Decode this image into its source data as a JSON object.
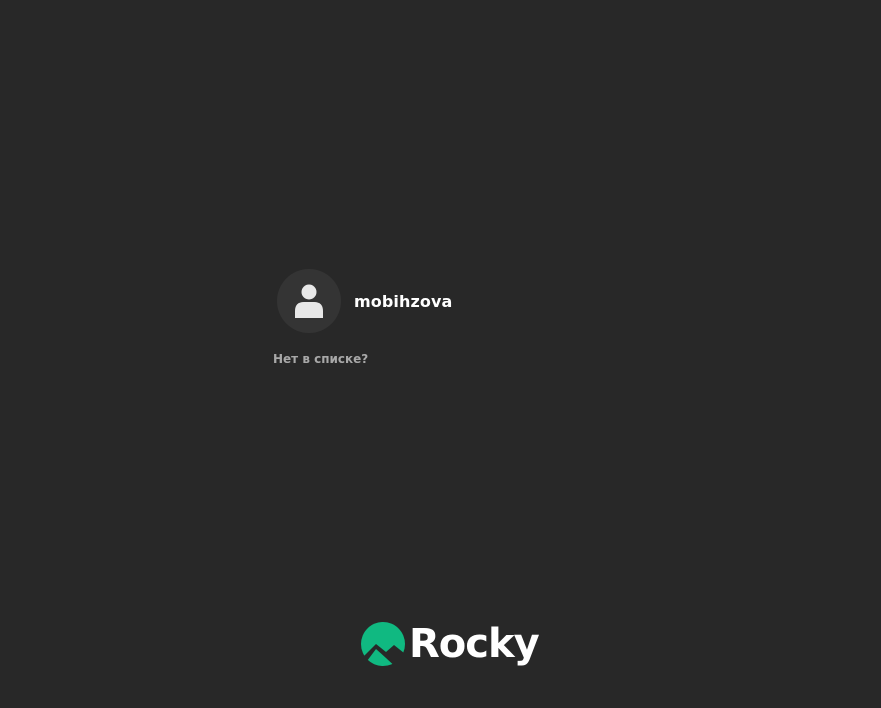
{
  "users": [
    {
      "name": "mobihzova",
      "avatar_icon": "user-silhouette-icon"
    }
  ],
  "not_listed_label": "Нет в списке?",
  "branding": {
    "logo_text": "Rocky",
    "logo_icon": "rocky-mountain-logo-icon",
    "accent_color": "#10b981"
  },
  "colors": {
    "background": "#282828",
    "avatar_background": "#343434"
  }
}
